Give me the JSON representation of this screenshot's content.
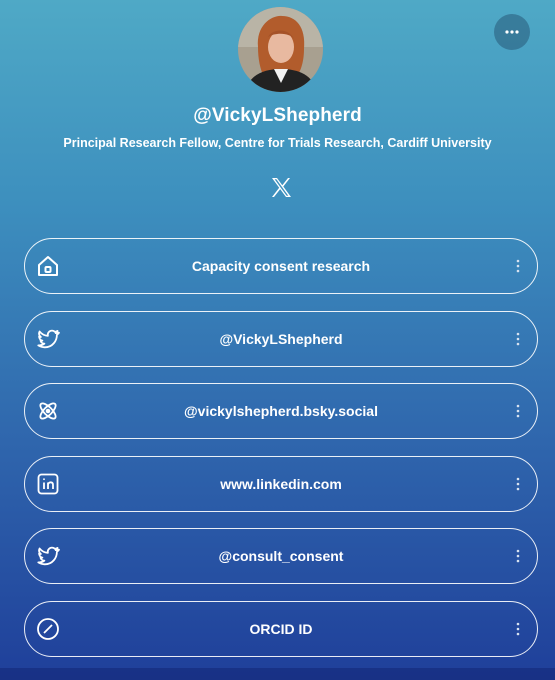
{
  "profile": {
    "handle": "@VickyLShepherd",
    "bio": "Principal Research Fellow, Centre for Trials Research, Cardiff University"
  },
  "header": {
    "more_icon": "more-horizontal-icon",
    "social_icon": "x-logo-icon"
  },
  "links": [
    {
      "label": "Capacity consent research",
      "icon": "home-icon"
    },
    {
      "label": "@VickyLShepherd",
      "icon": "twitter-icon"
    },
    {
      "label": "@vickylshepherd.bsky.social",
      "icon": "atom-icon"
    },
    {
      "label": "www.linkedin.com",
      "icon": "linkedin-icon"
    },
    {
      "label": "@consult_consent",
      "icon": "twitter-icon"
    },
    {
      "label": "ORCID ID",
      "icon": "compass-icon"
    }
  ],
  "colors": {
    "gradient_top": "#4fa9c6",
    "gradient_bottom": "#1f3f9a",
    "text": "#ffffff"
  }
}
